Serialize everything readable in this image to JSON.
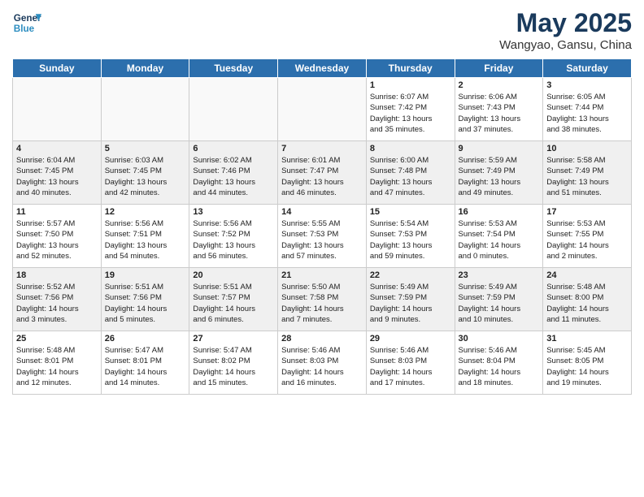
{
  "logo": {
    "line1": "General",
    "line2": "Blue"
  },
  "title": "May 2025",
  "subtitle": "Wangyao, Gansu, China",
  "days_of_week": [
    "Sunday",
    "Monday",
    "Tuesday",
    "Wednesday",
    "Thursday",
    "Friday",
    "Saturday"
  ],
  "weeks": [
    [
      {
        "num": "",
        "text": "",
        "empty": true
      },
      {
        "num": "",
        "text": "",
        "empty": true
      },
      {
        "num": "",
        "text": "",
        "empty": true
      },
      {
        "num": "",
        "text": "",
        "empty": true
      },
      {
        "num": "1",
        "text": "Sunrise: 6:07 AM\nSunset: 7:42 PM\nDaylight: 13 hours\nand 35 minutes.",
        "empty": false
      },
      {
        "num": "2",
        "text": "Sunrise: 6:06 AM\nSunset: 7:43 PM\nDaylight: 13 hours\nand 37 minutes.",
        "empty": false
      },
      {
        "num": "3",
        "text": "Sunrise: 6:05 AM\nSunset: 7:44 PM\nDaylight: 13 hours\nand 38 minutes.",
        "empty": false
      }
    ],
    [
      {
        "num": "4",
        "text": "Sunrise: 6:04 AM\nSunset: 7:45 PM\nDaylight: 13 hours\nand 40 minutes.",
        "empty": false
      },
      {
        "num": "5",
        "text": "Sunrise: 6:03 AM\nSunset: 7:45 PM\nDaylight: 13 hours\nand 42 minutes.",
        "empty": false
      },
      {
        "num": "6",
        "text": "Sunrise: 6:02 AM\nSunset: 7:46 PM\nDaylight: 13 hours\nand 44 minutes.",
        "empty": false
      },
      {
        "num": "7",
        "text": "Sunrise: 6:01 AM\nSunset: 7:47 PM\nDaylight: 13 hours\nand 46 minutes.",
        "empty": false
      },
      {
        "num": "8",
        "text": "Sunrise: 6:00 AM\nSunset: 7:48 PM\nDaylight: 13 hours\nand 47 minutes.",
        "empty": false
      },
      {
        "num": "9",
        "text": "Sunrise: 5:59 AM\nSunset: 7:49 PM\nDaylight: 13 hours\nand 49 minutes.",
        "empty": false
      },
      {
        "num": "10",
        "text": "Sunrise: 5:58 AM\nSunset: 7:49 PM\nDaylight: 13 hours\nand 51 minutes.",
        "empty": false
      }
    ],
    [
      {
        "num": "11",
        "text": "Sunrise: 5:57 AM\nSunset: 7:50 PM\nDaylight: 13 hours\nand 52 minutes.",
        "empty": false
      },
      {
        "num": "12",
        "text": "Sunrise: 5:56 AM\nSunset: 7:51 PM\nDaylight: 13 hours\nand 54 minutes.",
        "empty": false
      },
      {
        "num": "13",
        "text": "Sunrise: 5:56 AM\nSunset: 7:52 PM\nDaylight: 13 hours\nand 56 minutes.",
        "empty": false
      },
      {
        "num": "14",
        "text": "Sunrise: 5:55 AM\nSunset: 7:53 PM\nDaylight: 13 hours\nand 57 minutes.",
        "empty": false
      },
      {
        "num": "15",
        "text": "Sunrise: 5:54 AM\nSunset: 7:53 PM\nDaylight: 13 hours\nand 59 minutes.",
        "empty": false
      },
      {
        "num": "16",
        "text": "Sunrise: 5:53 AM\nSunset: 7:54 PM\nDaylight: 14 hours\nand 0 minutes.",
        "empty": false
      },
      {
        "num": "17",
        "text": "Sunrise: 5:53 AM\nSunset: 7:55 PM\nDaylight: 14 hours\nand 2 minutes.",
        "empty": false
      }
    ],
    [
      {
        "num": "18",
        "text": "Sunrise: 5:52 AM\nSunset: 7:56 PM\nDaylight: 14 hours\nand 3 minutes.",
        "empty": false
      },
      {
        "num": "19",
        "text": "Sunrise: 5:51 AM\nSunset: 7:56 PM\nDaylight: 14 hours\nand 5 minutes.",
        "empty": false
      },
      {
        "num": "20",
        "text": "Sunrise: 5:51 AM\nSunset: 7:57 PM\nDaylight: 14 hours\nand 6 minutes.",
        "empty": false
      },
      {
        "num": "21",
        "text": "Sunrise: 5:50 AM\nSunset: 7:58 PM\nDaylight: 14 hours\nand 7 minutes.",
        "empty": false
      },
      {
        "num": "22",
        "text": "Sunrise: 5:49 AM\nSunset: 7:59 PM\nDaylight: 14 hours\nand 9 minutes.",
        "empty": false
      },
      {
        "num": "23",
        "text": "Sunrise: 5:49 AM\nSunset: 7:59 PM\nDaylight: 14 hours\nand 10 minutes.",
        "empty": false
      },
      {
        "num": "24",
        "text": "Sunrise: 5:48 AM\nSunset: 8:00 PM\nDaylight: 14 hours\nand 11 minutes.",
        "empty": false
      }
    ],
    [
      {
        "num": "25",
        "text": "Sunrise: 5:48 AM\nSunset: 8:01 PM\nDaylight: 14 hours\nand 12 minutes.",
        "empty": false
      },
      {
        "num": "26",
        "text": "Sunrise: 5:47 AM\nSunset: 8:01 PM\nDaylight: 14 hours\nand 14 minutes.",
        "empty": false
      },
      {
        "num": "27",
        "text": "Sunrise: 5:47 AM\nSunset: 8:02 PM\nDaylight: 14 hours\nand 15 minutes.",
        "empty": false
      },
      {
        "num": "28",
        "text": "Sunrise: 5:46 AM\nSunset: 8:03 PM\nDaylight: 14 hours\nand 16 minutes.",
        "empty": false
      },
      {
        "num": "29",
        "text": "Sunrise: 5:46 AM\nSunset: 8:03 PM\nDaylight: 14 hours\nand 17 minutes.",
        "empty": false
      },
      {
        "num": "30",
        "text": "Sunrise: 5:46 AM\nSunset: 8:04 PM\nDaylight: 14 hours\nand 18 minutes.",
        "empty": false
      },
      {
        "num": "31",
        "text": "Sunrise: 5:45 AM\nSunset: 8:05 PM\nDaylight: 14 hours\nand 19 minutes.",
        "empty": false
      }
    ]
  ]
}
